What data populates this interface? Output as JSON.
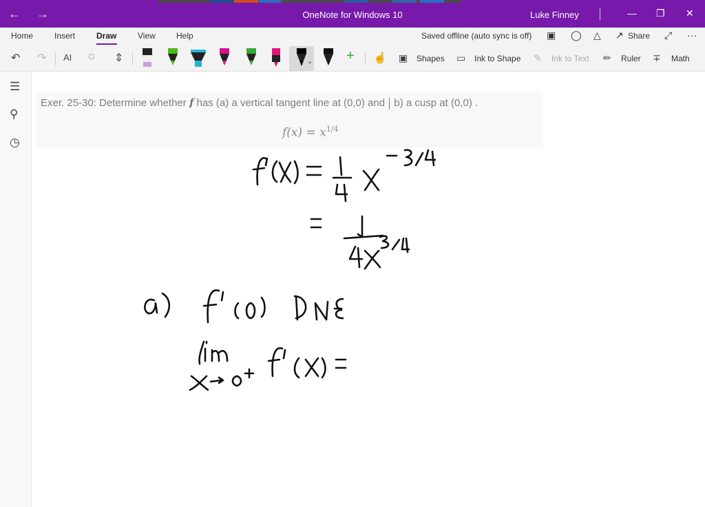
{
  "window": {
    "title": "OneNote for Windows 10",
    "user": "Luke Finney"
  },
  "ribbon": {
    "tabs": [
      {
        "label": "Home"
      },
      {
        "label": "Insert"
      },
      {
        "label": "Draw"
      },
      {
        "label": "View"
      },
      {
        "label": "Help"
      }
    ],
    "active_tab": "Draw",
    "sync_status": "Saved offline (auto sync is off)",
    "share_label": "Share",
    "more_label": "···"
  },
  "toolbar": {
    "shapes_label": "Shapes",
    "ink_to_shape_label": "Ink to Shape",
    "ink_to_text_label": "Ink to Text",
    "ruler_label": "Ruler",
    "math_label": "Math",
    "add_pen_label": "+",
    "lasso_icon_label": "AI",
    "pens": [
      {
        "name": "pencil",
        "color": "#c9a0dc"
      },
      {
        "name": "green-pen",
        "color": "#4cbb17"
      },
      {
        "name": "cyan-highlighter",
        "color": "#1fb6d6"
      },
      {
        "name": "magenta-pen",
        "color": "#d4148b"
      },
      {
        "name": "green-pen-2",
        "color": "#36a83a"
      },
      {
        "name": "pink-pen",
        "color": "#e0147a"
      },
      {
        "name": "black-pen-selected",
        "color": "#000000"
      },
      {
        "name": "black-pen",
        "color": "#111111"
      }
    ]
  },
  "page": {
    "exercise_prefix": "Exer. 25-30: Determine whether",
    "exercise_f": "f",
    "exercise_middle": "has (a) a vertical tangent line at (0,0) and",
    "exercise_end": "b) a cusp at (0,0) .",
    "formula_base": "f(x) = x",
    "formula_exp": "1/4"
  },
  "colors": {
    "title_bar": "#7719aa",
    "ribbon_bg": "#f3f3f3",
    "accent": "#7719aa"
  }
}
